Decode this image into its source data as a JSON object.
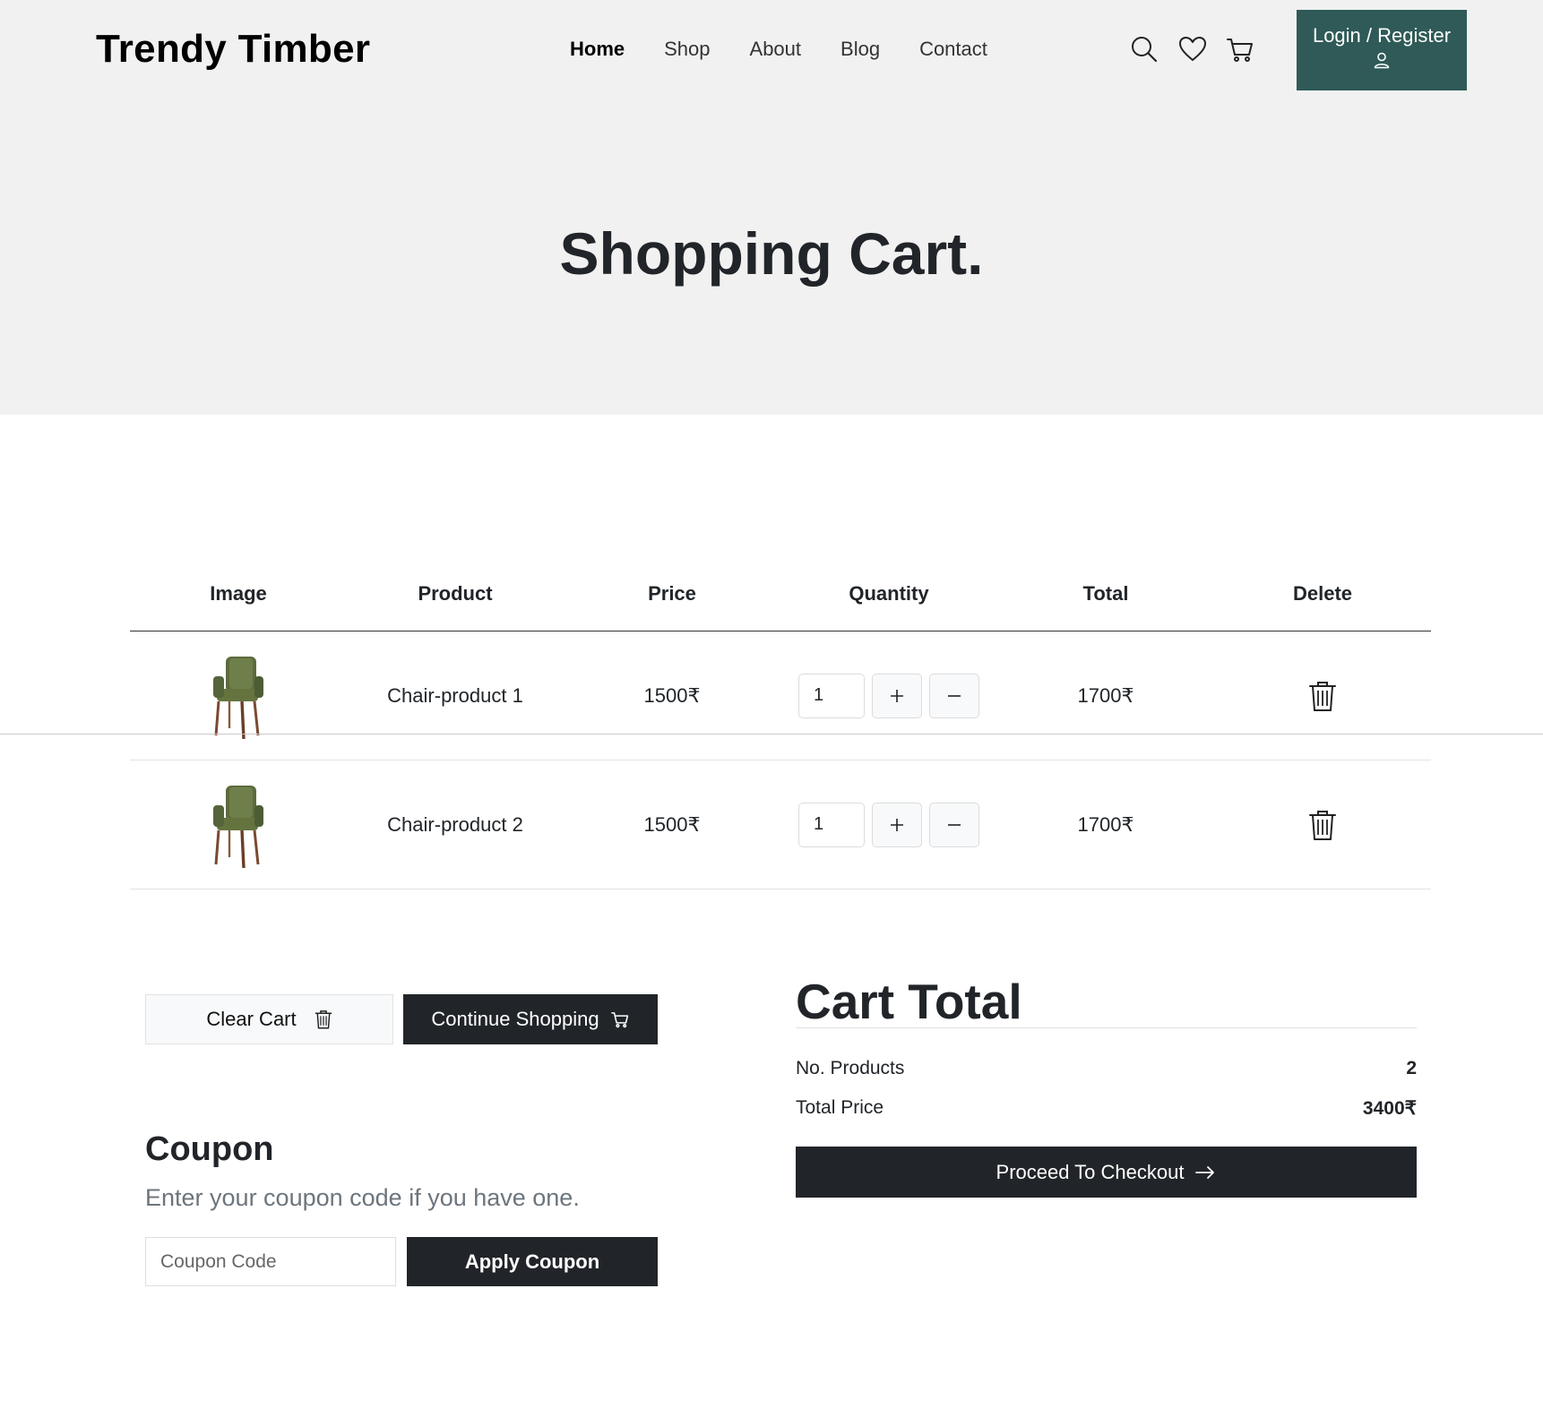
{
  "header": {
    "brand": "Trendy Timber",
    "nav": [
      {
        "label": "Home",
        "active": true
      },
      {
        "label": "Shop"
      },
      {
        "label": "About"
      },
      {
        "label": "Blog"
      },
      {
        "label": "Contact"
      }
    ],
    "icons": [
      "search-icon",
      "heart-icon",
      "cart-icon"
    ],
    "login_label": "Login / Register",
    "login_icon": "user-icon",
    "accent_color": "#2f5a57"
  },
  "hero": {
    "title": "Shopping Cart."
  },
  "table": {
    "headers": [
      "Image",
      "Product",
      "Price",
      "Quantity",
      "Total",
      "Delete"
    ],
    "rows": [
      {
        "image": "green-armchair",
        "product": "Chair-product 1",
        "price": "1500₹",
        "quantity": "1",
        "plus": "+",
        "minus": "−",
        "total": "1700₹",
        "delete_icon": "trash-icon"
      },
      {
        "image": "green-armchair",
        "product": "Chair-product 2",
        "price": "1500₹",
        "quantity": "1",
        "plus": "+",
        "minus": "−",
        "total": "1700₹",
        "delete_icon": "trash-icon"
      }
    ]
  },
  "actions": {
    "clear_cart": "Clear Cart",
    "continue_shopping": "Continue Shopping"
  },
  "coupon": {
    "title": "Coupon",
    "subtitle": "Enter your coupon code if you have one.",
    "placeholder": "Coupon Code",
    "apply": "Apply Coupon"
  },
  "cart_total": {
    "title": "Cart Total",
    "products_label": "No. Products",
    "products_value": "2",
    "price_label": "Total Price",
    "price_value": "3400₹",
    "checkout": "Proceed To Checkout"
  }
}
